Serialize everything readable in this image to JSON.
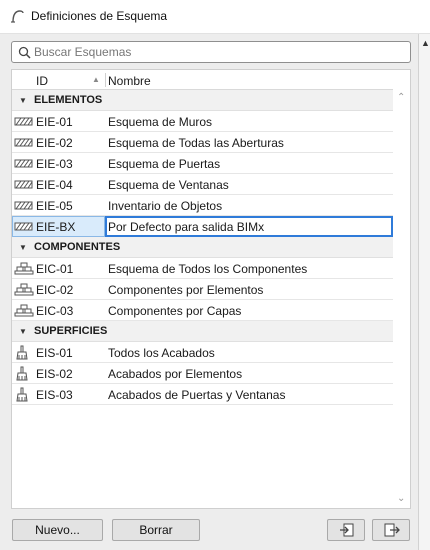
{
  "window": {
    "title": "Definiciones de Esquema"
  },
  "search": {
    "placeholder": "Buscar Esquemas",
    "value": ""
  },
  "table": {
    "columns": {
      "id": "ID",
      "name": "Nombre"
    },
    "groups": [
      {
        "label": "ELEMENTOS",
        "rows": [
          {
            "id": "EIE-01",
            "name": "Esquema de Muros"
          },
          {
            "id": "EIE-02",
            "name": "Esquema de Todas las Aberturas"
          },
          {
            "id": "EIE-03",
            "name": "Esquema de Puertas"
          },
          {
            "id": "EIE-04",
            "name": "Esquema de Ventanas"
          },
          {
            "id": "EIE-05",
            "name": "Inventario de Objetos"
          },
          {
            "id": "EIE-BX",
            "name": "Por Defecto para salida BIMx"
          }
        ]
      },
      {
        "label": "COMPONENTES",
        "rows": [
          {
            "id": "EIC-01",
            "name": "Esquema de Todos los Componentes"
          },
          {
            "id": "EIC-02",
            "name": "Componentes por Elementos"
          },
          {
            "id": "EIC-03",
            "name": "Componentes por Capas"
          }
        ]
      },
      {
        "label": "SUPERFICIES",
        "rows": [
          {
            "id": "EIS-01",
            "name": "Todos los Acabados"
          },
          {
            "id": "EIS-02",
            "name": "Acabados por Elementos"
          },
          {
            "id": "EIS-03",
            "name": "Acabados de Puertas y Ventanas"
          }
        ]
      }
    ],
    "selected_row_id": "EIE-BX"
  },
  "icons": {
    "elements_row": "hatched-element-icon",
    "components_row": "layered-components-icon",
    "surfaces_row": "paint-brush-icon",
    "search": "search-icon",
    "title": "app-arc-icon",
    "import": "import-icon",
    "export": "export-icon"
  },
  "buttons": {
    "new_label": "Nuevo...",
    "delete_label": "Borrar"
  },
  "colors": {
    "selection": "#2f7bd9",
    "selection_fill": "#d9ebfb",
    "group_bg": "#f1f1f1"
  }
}
